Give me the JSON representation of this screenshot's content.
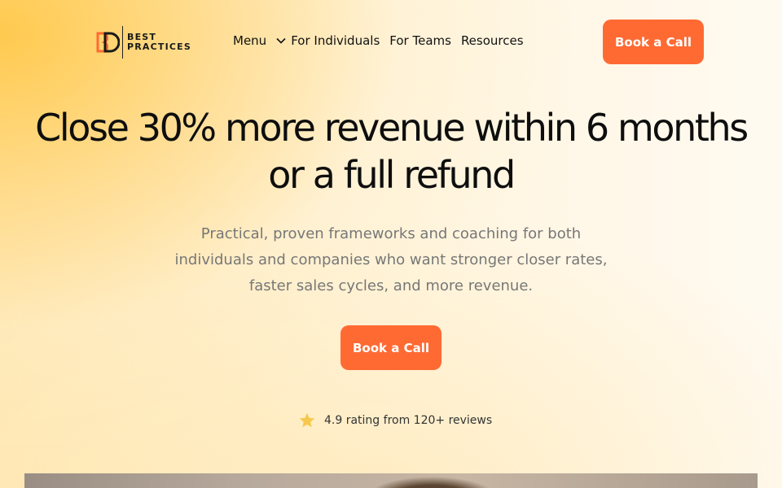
{
  "brand": {
    "logo_line1": "BEST",
    "logo_line2": "PRACTICES",
    "accent_color": "#ff6a33"
  },
  "nav": {
    "items": [
      {
        "label": "Menu",
        "has_dropdown": true
      },
      {
        "label": "For Individuals"
      },
      {
        "label": "For Teams"
      },
      {
        "label": "Resources"
      }
    ],
    "cta_label": "Book a Call"
  },
  "hero": {
    "headline_line1": "Close 30% more revenue within 6 months",
    "headline_line2": "or a full refund",
    "sub_line1": "Practical, proven frameworks and coaching for both",
    "sub_line2": "individuals and companies who want stronger closer rates,",
    "sub_line3": "faster sales cycles, and more revenue.",
    "cta_label": "Book a Call",
    "rating_text": "4.9 rating from 120+ reviews",
    "rating_icon": "star-icon"
  }
}
